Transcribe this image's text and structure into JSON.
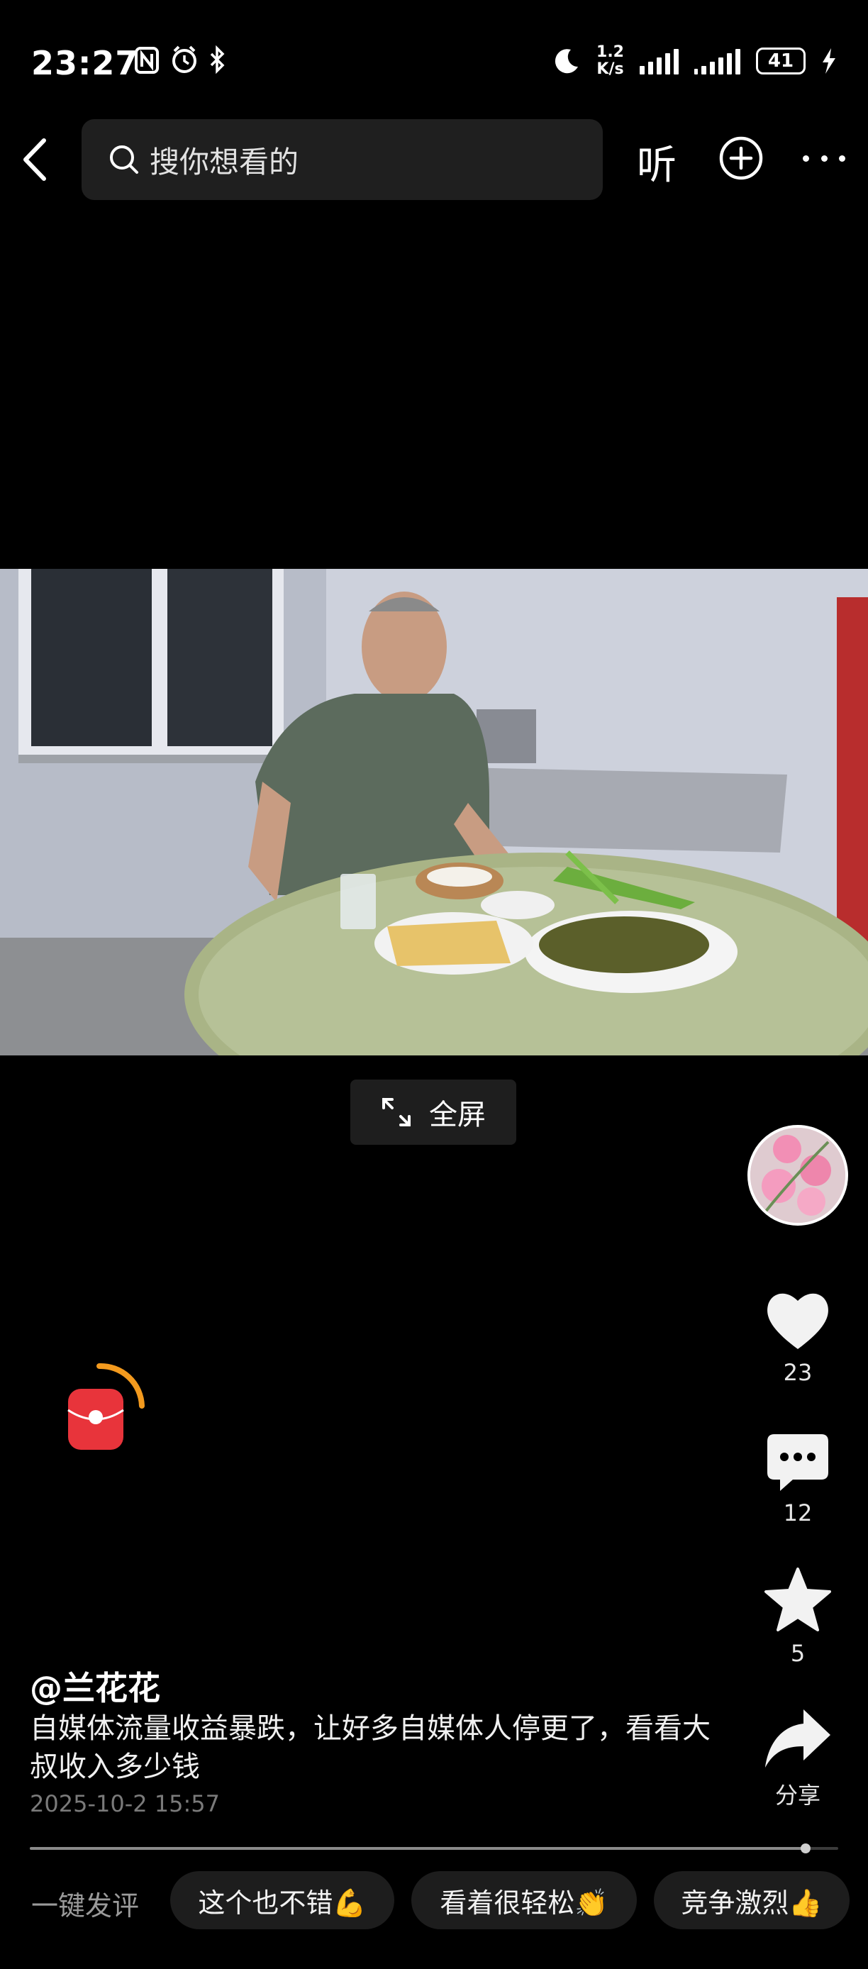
{
  "status_bar": {
    "time": "23:27",
    "speed_value": "1.2",
    "speed_unit": "K/s",
    "battery": "41"
  },
  "top_bar": {
    "search_placeholder": "搜你想看的",
    "listen_label": "听"
  },
  "video": {
    "fullscreen_label": "全屏"
  },
  "actions": {
    "like_count": "23",
    "comment_count": "12",
    "favorite_count": "5",
    "share_label": "分享"
  },
  "post": {
    "author": "@兰花花",
    "description": "自媒体流量收益暴跌，让好多自媒体人停更了，看看大叔收入多少钱",
    "date": "2025-10-2 15:57",
    "progress_fraction": 0.96
  },
  "quick_comments": {
    "label": "一键发评",
    "chips": [
      "这个也不错💪",
      "看着很轻松👏",
      "竞争激烈👍"
    ]
  },
  "colors": {
    "background": "#000000",
    "search_bg": "#1f1f1f",
    "red_packet": "#e8343b",
    "red_packet_arc": "#f39a1e"
  }
}
